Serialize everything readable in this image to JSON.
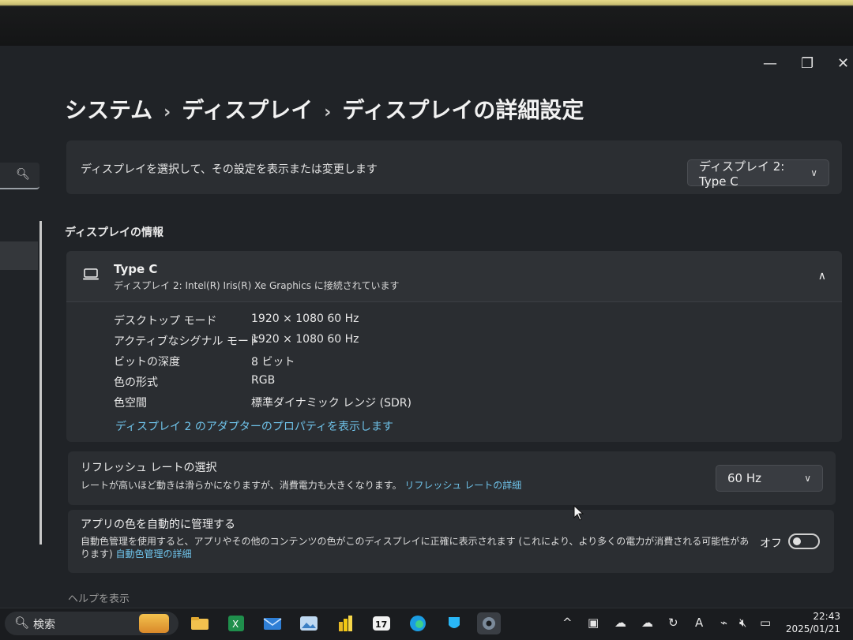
{
  "window": {
    "minimize_glyph": "—",
    "maximize_glyph": "❐",
    "close_glyph": "✕"
  },
  "breadcrumb": {
    "items": [
      "システム",
      "ディスプレイ",
      "ディスプレイの詳細設定"
    ],
    "separator": "›"
  },
  "search": {
    "icon": "search-icon"
  },
  "display_select": {
    "prompt": "ディスプレイを選択して、その設定を表示または変更します",
    "selected": "ディスプレイ 2: Type C"
  },
  "display_info": {
    "section_title": "ディスプレイの情報",
    "device_name": "Type C",
    "connection": "ディスプレイ 2: Intel(R) Iris(R) Xe Graphics に接続されています",
    "properties": [
      {
        "label": "デスクトップ モード",
        "value": "1920 × 1080 60 Hz"
      },
      {
        "label": "アクティブなシグナル モード",
        "value": "1920 × 1080 60 Hz"
      },
      {
        "label": "ビットの深度",
        "value": "8 ビット"
      },
      {
        "label": "色の形式",
        "value": "RGB"
      },
      {
        "label": "色空間",
        "value": "標準ダイナミック レンジ (SDR)"
      }
    ],
    "adapter_link": "ディスプレイ 2 のアダプターのプロパティを表示します"
  },
  "refresh_rate": {
    "title": "リフレッシュ レートの選択",
    "description": "レートが高いほど動きは滑らかになりますが、消費電力も大きくなります。",
    "link": "リフレッシュ レートの詳細",
    "selected": "60 Hz"
  },
  "color_management": {
    "title": "アプリの色を自動的に管理する",
    "description": "自動色管理を使用すると、アプリやその他のコンテンツの色がこのディスプレイに正確に表示されます (これにより、より多くの電力が消費される可能性があります)",
    "link": "自動色管理の詳細",
    "toggle_label": "オフ",
    "toggle_on": false
  },
  "help_peek": "ヘルプを表示",
  "taskbar": {
    "search_label": "検索",
    "apps": [
      "file-explorer-icon",
      "excel-icon",
      "mail-icon",
      "photos-icon",
      "power-bi-icon",
      "tradingview-icon",
      "edge-icon",
      "app-icon",
      "settings-icon"
    ],
    "tray": {
      "chevron": "^",
      "ime": "A"
    },
    "time": "22:43",
    "date": "2025/01/21"
  },
  "colors": {
    "accent_link": "#6fc3ea",
    "card_bg": "#2b2e32",
    "window_bg": "#202327"
  }
}
